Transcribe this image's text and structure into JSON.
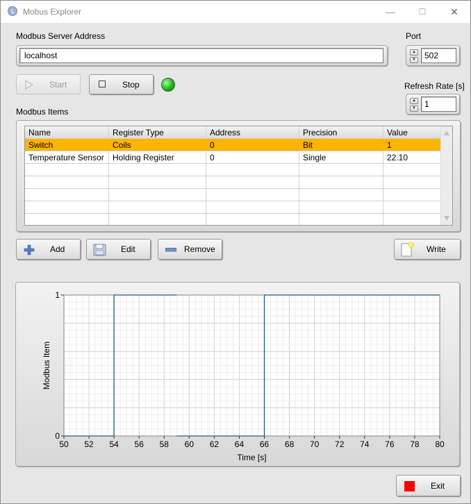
{
  "window": {
    "title": "Mobus Explorer",
    "controls": {
      "minimize": "—",
      "maximize": "☐",
      "close": "✕"
    }
  },
  "server": {
    "label": "Modbus Server Address",
    "value": "localhost"
  },
  "port": {
    "label": "Port",
    "value": "502"
  },
  "refresh": {
    "label": "Refresh Rate [s]",
    "value": "1"
  },
  "controls": {
    "start_label": "Start",
    "stop_label": "Stop",
    "status_color": "#18b818"
  },
  "items": {
    "label": "Modbus Items",
    "columns": [
      "Name",
      "Register Type",
      "Address",
      "Precision",
      "Value"
    ],
    "rows": [
      [
        "Switch",
        "Coils",
        "0",
        "Bit",
        "1"
      ],
      [
        "Temperature Sensor",
        "Holding Register",
        "0",
        "Single",
        "22.10"
      ]
    ],
    "selected_row": 0,
    "selection_color": "#ffb400"
  },
  "actions": {
    "add_label": "Add",
    "edit_label": "Edit",
    "remove_label": "Remove",
    "write_label": "Write",
    "exit_label": "Exit"
  },
  "chart_data": {
    "type": "line",
    "title": "",
    "xlabel": "Time [s]",
    "ylabel": "Modbus Item",
    "xlim": [
      50,
      80
    ],
    "ylim": [
      0,
      1
    ],
    "xticks": [
      50,
      52,
      54,
      56,
      58,
      60,
      62,
      64,
      66,
      68,
      70,
      72,
      74,
      76,
      78,
      80
    ],
    "yticks": [
      0,
      1
    ],
    "grid": true,
    "line_color": "#1f5e82",
    "series": [
      {
        "segments": [
          {
            "x": [
              50,
              54,
              54,
              59
            ],
            "y": [
              0,
              0,
              1,
              1
            ]
          },
          {
            "x": [
              59,
              66,
              66,
              80
            ],
            "y": [
              0,
              0,
              1,
              1
            ]
          }
        ]
      }
    ]
  }
}
